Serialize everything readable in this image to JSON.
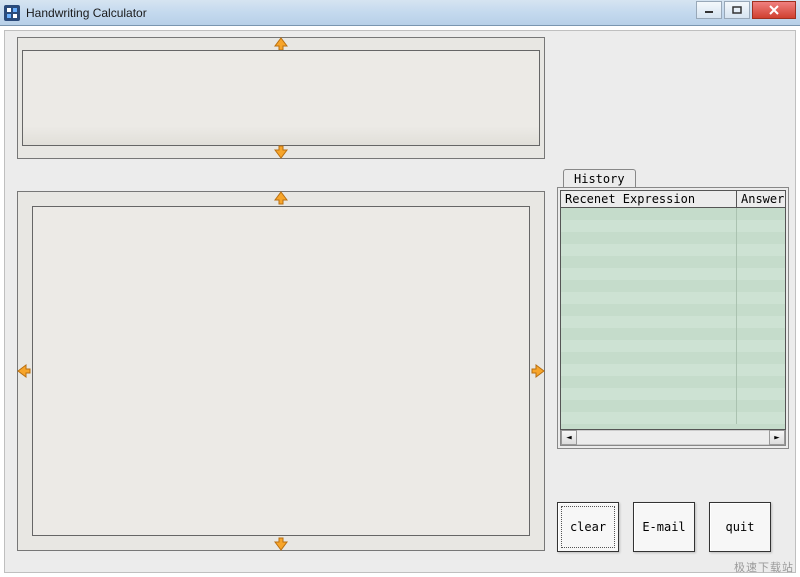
{
  "window": {
    "title": "Handwriting Calculator"
  },
  "tabs": {
    "history": "History"
  },
  "history": {
    "col_expression": "Recenet Expression",
    "col_answer": "Answer"
  },
  "buttons": {
    "clear": "clear",
    "email": "E-mail",
    "quit": "quit"
  },
  "watermark": "极速下载站",
  "colors": {
    "titlebar_gradient_top": "#d6e4f1",
    "titlebar_gradient_bottom": "#b8d0e8",
    "panel_bg": "#e8e7e3",
    "history_row_a": "#c5dccb",
    "history_row_b": "#cde2d3",
    "arrow_fill": "#f7a52a",
    "close_bg": "#d04030"
  }
}
